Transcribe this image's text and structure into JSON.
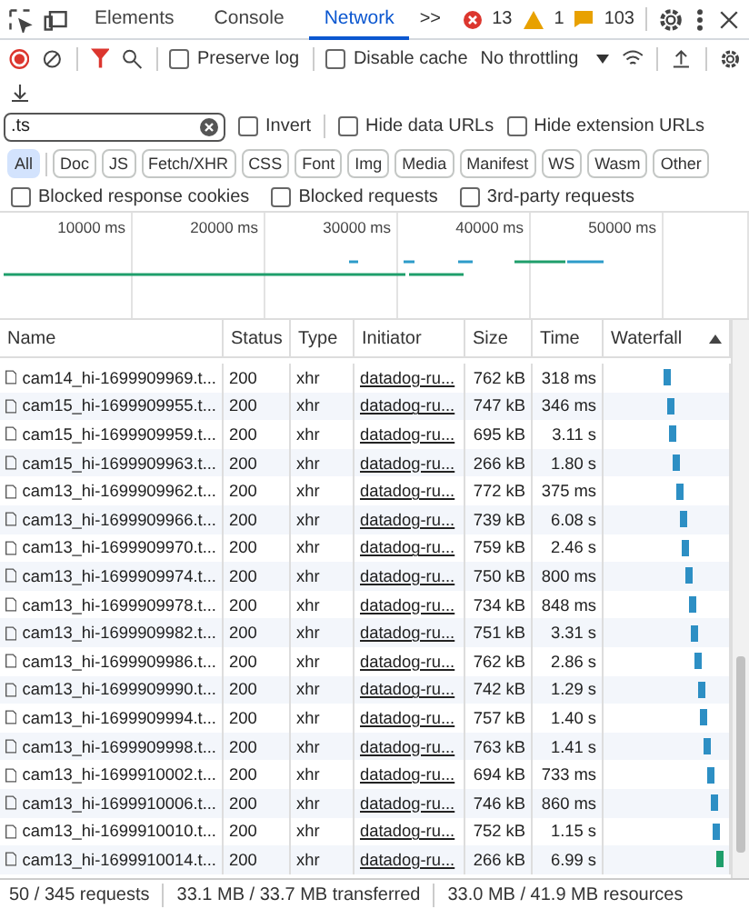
{
  "panel_tabs": [
    {
      "label": "Elements",
      "selected": false
    },
    {
      "label": "Console",
      "selected": false
    },
    {
      "label": "Network",
      "selected": true
    }
  ],
  "more_tabs": ">>",
  "counters": {
    "errors": "13",
    "warnings": "1",
    "issues": "103"
  },
  "toolbar": {
    "preserve_log": {
      "label": "Preserve log",
      "checked": false
    },
    "disable_cache": {
      "label": "Disable cache",
      "checked": false
    },
    "throttling": "No throttling"
  },
  "filter": {
    "value": ".ts",
    "options": [
      {
        "label": "Invert",
        "checked": false
      },
      {
        "label": "Hide data URLs",
        "checked": false
      },
      {
        "label": "Hide extension URLs",
        "checked": false
      }
    ]
  },
  "type_chips": [
    {
      "label": "All",
      "selected": true
    },
    {
      "label": "Doc",
      "selected": false
    },
    {
      "label": "JS",
      "selected": false
    },
    {
      "label": "Fetch/XHR",
      "selected": false
    },
    {
      "label": "CSS",
      "selected": false
    },
    {
      "label": "Font",
      "selected": false
    },
    {
      "label": "Img",
      "selected": false
    },
    {
      "label": "Media",
      "selected": false
    },
    {
      "label": "Manifest",
      "selected": false
    },
    {
      "label": "WS",
      "selected": false
    },
    {
      "label": "Wasm",
      "selected": false
    },
    {
      "label": "Other",
      "selected": false
    }
  ],
  "blocked_options": [
    {
      "label": "Blocked response cookies",
      "checked": false
    },
    {
      "label": "Blocked requests",
      "checked": false
    },
    {
      "label": "3rd-party requests",
      "checked": false
    }
  ],
  "overview": {
    "ticks": [
      "10000 ms",
      "20000 ms",
      "30000 ms",
      "40000 ms",
      "50000 ms"
    ]
  },
  "table": {
    "columns": [
      "Name",
      "Status",
      "Type",
      "Initiator",
      "Size",
      "Time",
      "Waterfall"
    ],
    "rows": [
      {
        "name": "cam14_hi-1699909969.t...",
        "status": "200",
        "type": "xhr",
        "initiator": "datadog-ru...",
        "size": "762 kB",
        "time": "318 ms"
      },
      {
        "name": "cam15_hi-1699909955.t...",
        "status": "200",
        "type": "xhr",
        "initiator": "datadog-ru...",
        "size": "747 kB",
        "time": "346 ms"
      },
      {
        "name": "cam15_hi-1699909959.t...",
        "status": "200",
        "type": "xhr",
        "initiator": "datadog-ru...",
        "size": "695 kB",
        "time": "3.11 s"
      },
      {
        "name": "cam15_hi-1699909963.t...",
        "status": "200",
        "type": "xhr",
        "initiator": "datadog-ru...",
        "size": "266 kB",
        "time": "1.80 s"
      },
      {
        "name": "cam13_hi-1699909962.t...",
        "status": "200",
        "type": "xhr",
        "initiator": "datadog-ru...",
        "size": "772 kB",
        "time": "375 ms"
      },
      {
        "name": "cam13_hi-1699909966.t...",
        "status": "200",
        "type": "xhr",
        "initiator": "datadog-ru...",
        "size": "739 kB",
        "time": "6.08 s"
      },
      {
        "name": "cam13_hi-1699909970.t...",
        "status": "200",
        "type": "xhr",
        "initiator": "datadog-ru...",
        "size": "759 kB",
        "time": "2.46 s"
      },
      {
        "name": "cam13_hi-1699909974.t...",
        "status": "200",
        "type": "xhr",
        "initiator": "datadog-ru...",
        "size": "750 kB",
        "time": "800 ms"
      },
      {
        "name": "cam13_hi-1699909978.t...",
        "status": "200",
        "type": "xhr",
        "initiator": "datadog-ru...",
        "size": "734 kB",
        "time": "848 ms"
      },
      {
        "name": "cam13_hi-1699909982.t...",
        "status": "200",
        "type": "xhr",
        "initiator": "datadog-ru...",
        "size": "751 kB",
        "time": "3.31 s"
      },
      {
        "name": "cam13_hi-1699909986.t...",
        "status": "200",
        "type": "xhr",
        "initiator": "datadog-ru...",
        "size": "762 kB",
        "time": "2.86 s"
      },
      {
        "name": "cam13_hi-1699909990.t...",
        "status": "200",
        "type": "xhr",
        "initiator": "datadog-ru...",
        "size": "742 kB",
        "time": "1.29 s"
      },
      {
        "name": "cam13_hi-1699909994.t...",
        "status": "200",
        "type": "xhr",
        "initiator": "datadog-ru...",
        "size": "757 kB",
        "time": "1.40 s"
      },
      {
        "name": "cam13_hi-1699909998.t...",
        "status": "200",
        "type": "xhr",
        "initiator": "datadog-ru...",
        "size": "763 kB",
        "time": "1.41 s"
      },
      {
        "name": "cam13_hi-1699910002.t...",
        "status": "200",
        "type": "xhr",
        "initiator": "datadog-ru...",
        "size": "694 kB",
        "time": "733 ms"
      },
      {
        "name": "cam13_hi-1699910006.t...",
        "status": "200",
        "type": "xhr",
        "initiator": "datadog-ru...",
        "size": "746 kB",
        "time": "860 ms"
      },
      {
        "name": "cam13_hi-1699910010.t...",
        "status": "200",
        "type": "xhr",
        "initiator": "datadog-ru...",
        "size": "752 kB",
        "time": "1.15 s"
      },
      {
        "name": "cam13_hi-1699910014.t...",
        "status": "200",
        "type": "xhr",
        "initiator": "datadog-ru...",
        "size": "266 kB",
        "time": "6.99 s"
      }
    ]
  },
  "status_bar": [
    "50 / 345 requests",
    "33.1 MB / 33.7 MB transferred",
    "33.0 MB / 41.9 MB resources"
  ]
}
